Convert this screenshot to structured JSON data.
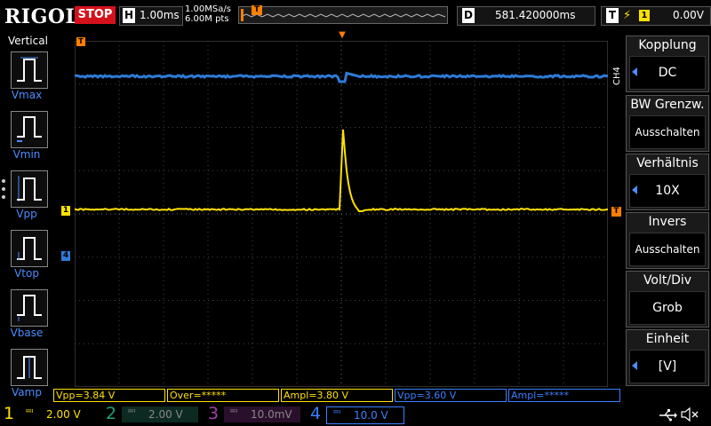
{
  "top": {
    "logo": "RIGOL",
    "run_state": "STOP",
    "horiz_key": "H",
    "timebase": "1.00ms",
    "sample_rate": "1.00MSa/s",
    "memory_depth": "6.00M pts",
    "trigger_marker": "T",
    "delay_key": "D",
    "delay": "581.420000ms",
    "trigger_key": "T",
    "trigger_edge": "⚡",
    "trigger_source": "1",
    "trigger_level": "0.00V"
  },
  "left_panel": {
    "title": "Vertical",
    "items": [
      "Vmax",
      "Vmin",
      "Vpp",
      "Vtop",
      "Vbase",
      "Vamp"
    ]
  },
  "markers": {
    "ch1": "1",
    "ch4": "4",
    "trig_left": "T",
    "trig_right": "T",
    "trig_top": "▼"
  },
  "right_menu": {
    "channel_tag": "CH4",
    "items": [
      {
        "title": "Kopplung",
        "value": "DC",
        "has_arrow": true
      },
      {
        "title": "BW Grenzw.",
        "value": "Ausschalten",
        "has_arrow": false
      },
      {
        "title": "Verhältnis",
        "value": "10X",
        "has_arrow": true
      },
      {
        "title": "Invers",
        "value": "Ausschalten",
        "has_arrow": false
      },
      {
        "title": "Volt/Div",
        "value": "Grob",
        "has_arrow": false
      },
      {
        "title": "Einheit",
        "value": "[V]",
        "has_arrow": true
      }
    ]
  },
  "readouts": [
    {
      "text": "Vpp=3.84 V",
      "color": "#ffe100"
    },
    {
      "text": "Over=*****",
      "color": "#ffe100"
    },
    {
      "text": "Ampl=3.80 V",
      "color": "#ffe100"
    },
    {
      "text": "Vpp=3.60 V",
      "color": "#3b7fff"
    },
    {
      "text": "Ampl=*****",
      "color": "#3b7fff"
    }
  ],
  "channels": [
    {
      "num": "1",
      "coupling": "≕",
      "scale": "2.00 V",
      "color": "#ffe100",
      "active": true
    },
    {
      "num": "2",
      "coupling": "≕",
      "scale": "2.00 V",
      "color": "#1aa37a",
      "active": false
    },
    {
      "num": "3",
      "coupling": "≕",
      "scale": "10.0mV",
      "color": "#a23fa8",
      "active": false
    },
    {
      "num": "4",
      "coupling": "≕",
      "scale": "10.0 V",
      "color": "#3b7fff",
      "active": true
    }
  ],
  "status_icons": {
    "usb": "usb-icon",
    "sound": "speaker-mute-icon"
  },
  "colors": {
    "ch1": "#ffe100",
    "ch4": "#2e7bd6",
    "trigger": "#ff7f00",
    "stop": "#d4121c"
  }
}
